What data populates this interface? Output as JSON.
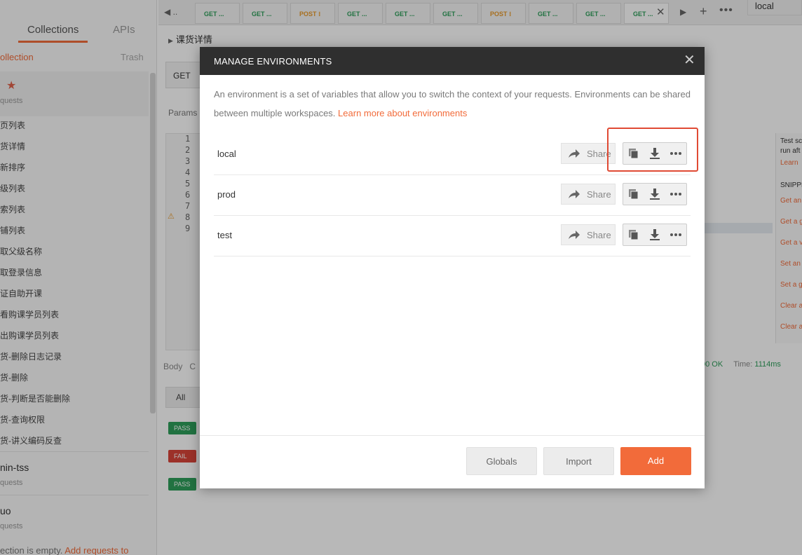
{
  "sidebar": {
    "tabs": [
      "Collections",
      "APIs"
    ],
    "new_collection": "ollection",
    "trash": "Trash",
    "requests_label": "quests",
    "items": [
      "页列表",
      "货详情",
      "新排序",
      "级列表",
      "索列表",
      "铺列表",
      "取父级名称",
      "取登录信息",
      "证自助开课",
      "看购课学员列表",
      "出购课学员列表",
      "货-删除日志记录",
      "货-删除",
      "货-判断是否能删除",
      "货-查询权限",
      "货-讲义编码反查"
    ],
    "collections": [
      {
        "name": "nin-tss",
        "requests": "quests"
      },
      {
        "name": "uo",
        "requests": "quests"
      }
    ],
    "empty_text": "ection is empty.",
    "empty_link": "Add requests to"
  },
  "tabbar": {
    "tabs": [
      {
        "method": "GET",
        "text": "GET ..."
      },
      {
        "method": "GET",
        "text": "GET ..."
      },
      {
        "method": "POST",
        "text": "POST ⁝"
      },
      {
        "method": "GET",
        "text": "GET ..."
      },
      {
        "method": "GET",
        "text": "GET ..."
      },
      {
        "method": "GET",
        "text": "GET ..."
      },
      {
        "method": "POST",
        "text": "POST ⁝"
      },
      {
        "method": "GET",
        "text": "GET ..."
      },
      {
        "method": "GET",
        "text": "GET ..."
      },
      {
        "method": "GET",
        "text": "GET ..."
      }
    ],
    "env_selected": "local"
  },
  "request": {
    "title": "课货详情",
    "method": "GET",
    "params_label": "Params",
    "line_numbers": [
      "1",
      "2",
      "3",
      "4",
      "5",
      "6",
      "7",
      "8",
      "9"
    ],
    "body_label": "Body",
    "body_label_cut": "C",
    "status_code": "00 OK",
    "time_label": "Time:",
    "time_value": "1114ms",
    "all_label": "All",
    "results": [
      "PASS",
      "FAIL",
      "PASS"
    ]
  },
  "right_panel": {
    "lines": [
      {
        "text": "Test sc",
        "style": "dark"
      },
      {
        "text": "run aft",
        "style": "dark"
      },
      {
        "text": "Learn",
        "style": "or"
      },
      {
        "text": "SNIPPE",
        "style": "dark"
      },
      {
        "text": "Get an",
        "style": "or"
      },
      {
        "text": "Get a g",
        "style": "or"
      },
      {
        "text": "Get a v",
        "style": "or"
      },
      {
        "text": "Set an",
        "style": "or"
      },
      {
        "text": "Set a g",
        "style": "or"
      },
      {
        "text": "Clear a",
        "style": "or"
      },
      {
        "text": "Clear a",
        "style": "or"
      }
    ]
  },
  "modal": {
    "title": "MANAGE ENVIRONMENTS",
    "description": "An environment is a set of variables that allow you to switch the context of your requests. Environments can be shared between multiple workspaces.",
    "learn_more": "Learn more about environments",
    "environments": [
      {
        "name": "local",
        "share_label": "Share"
      },
      {
        "name": "prod",
        "share_label": "Share"
      },
      {
        "name": "test",
        "share_label": "Share"
      }
    ],
    "buttons": {
      "globals": "Globals",
      "import": "Import",
      "add": "Add"
    }
  },
  "colors": {
    "accent": "#f26b3a",
    "highlight": "#e04a34",
    "header": "#2f2f2f",
    "get": "#2f9e5b",
    "post": "#e89a2c"
  }
}
